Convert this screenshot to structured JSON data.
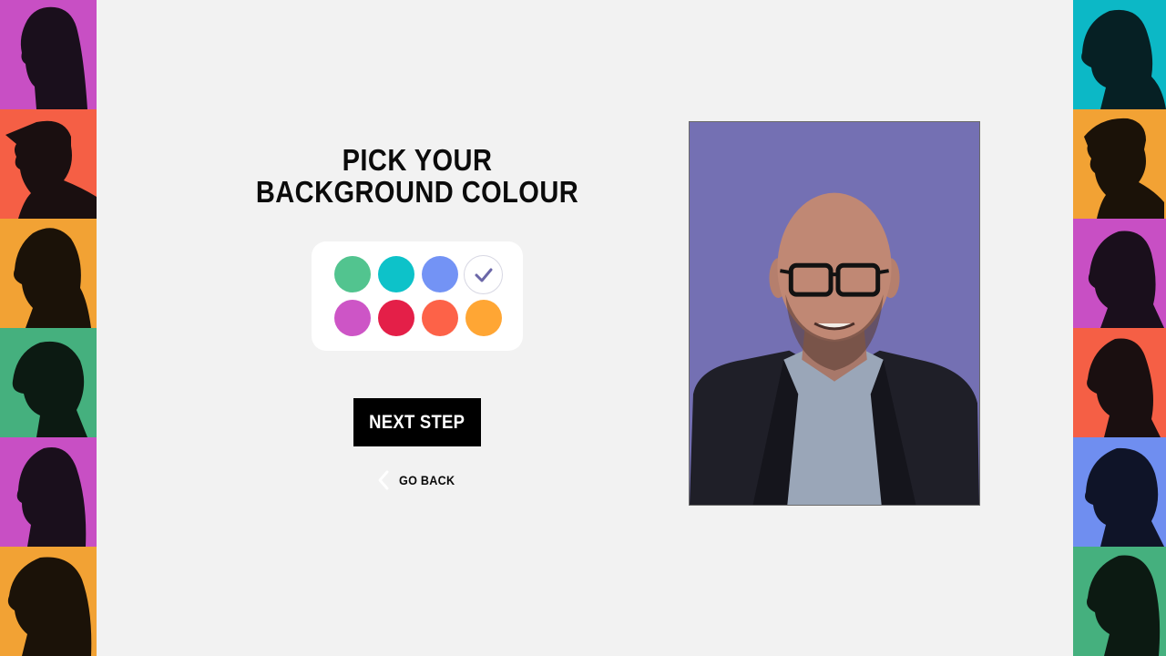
{
  "page": {
    "title": "PICK YOUR BACKGROUND COLOUR"
  },
  "swatches": [
    {
      "color": "#52c48f",
      "selected": false
    },
    {
      "color": "#0dc2c9",
      "selected": false
    },
    {
      "color": "#7393f5",
      "selected": false
    },
    {
      "color": "#7470b3",
      "selected": true
    },
    {
      "color": "#cd55c6",
      "selected": false
    },
    {
      "color": "#e41f48",
      "selected": false
    },
    {
      "color": "#fd6248",
      "selected": false
    },
    {
      "color": "#ffa634",
      "selected": false
    }
  ],
  "actions": {
    "next_label": "NEXT STEP",
    "back_label": "GO BACK"
  },
  "preview": {
    "background_color": "#7470b3"
  },
  "side_tiles": {
    "left": [
      "#c84fc4",
      "#f55f45",
      "#f2a234",
      "#45b07e",
      "#c84fc4",
      "#f2a234"
    ],
    "right": [
      "#0cb8c6",
      "#f2a234",
      "#c84fc4",
      "#f55f45",
      "#6f8ef0",
      "#45b07e"
    ]
  },
  "icons": {
    "check": "check-icon",
    "back": "chevron-left-icon"
  }
}
